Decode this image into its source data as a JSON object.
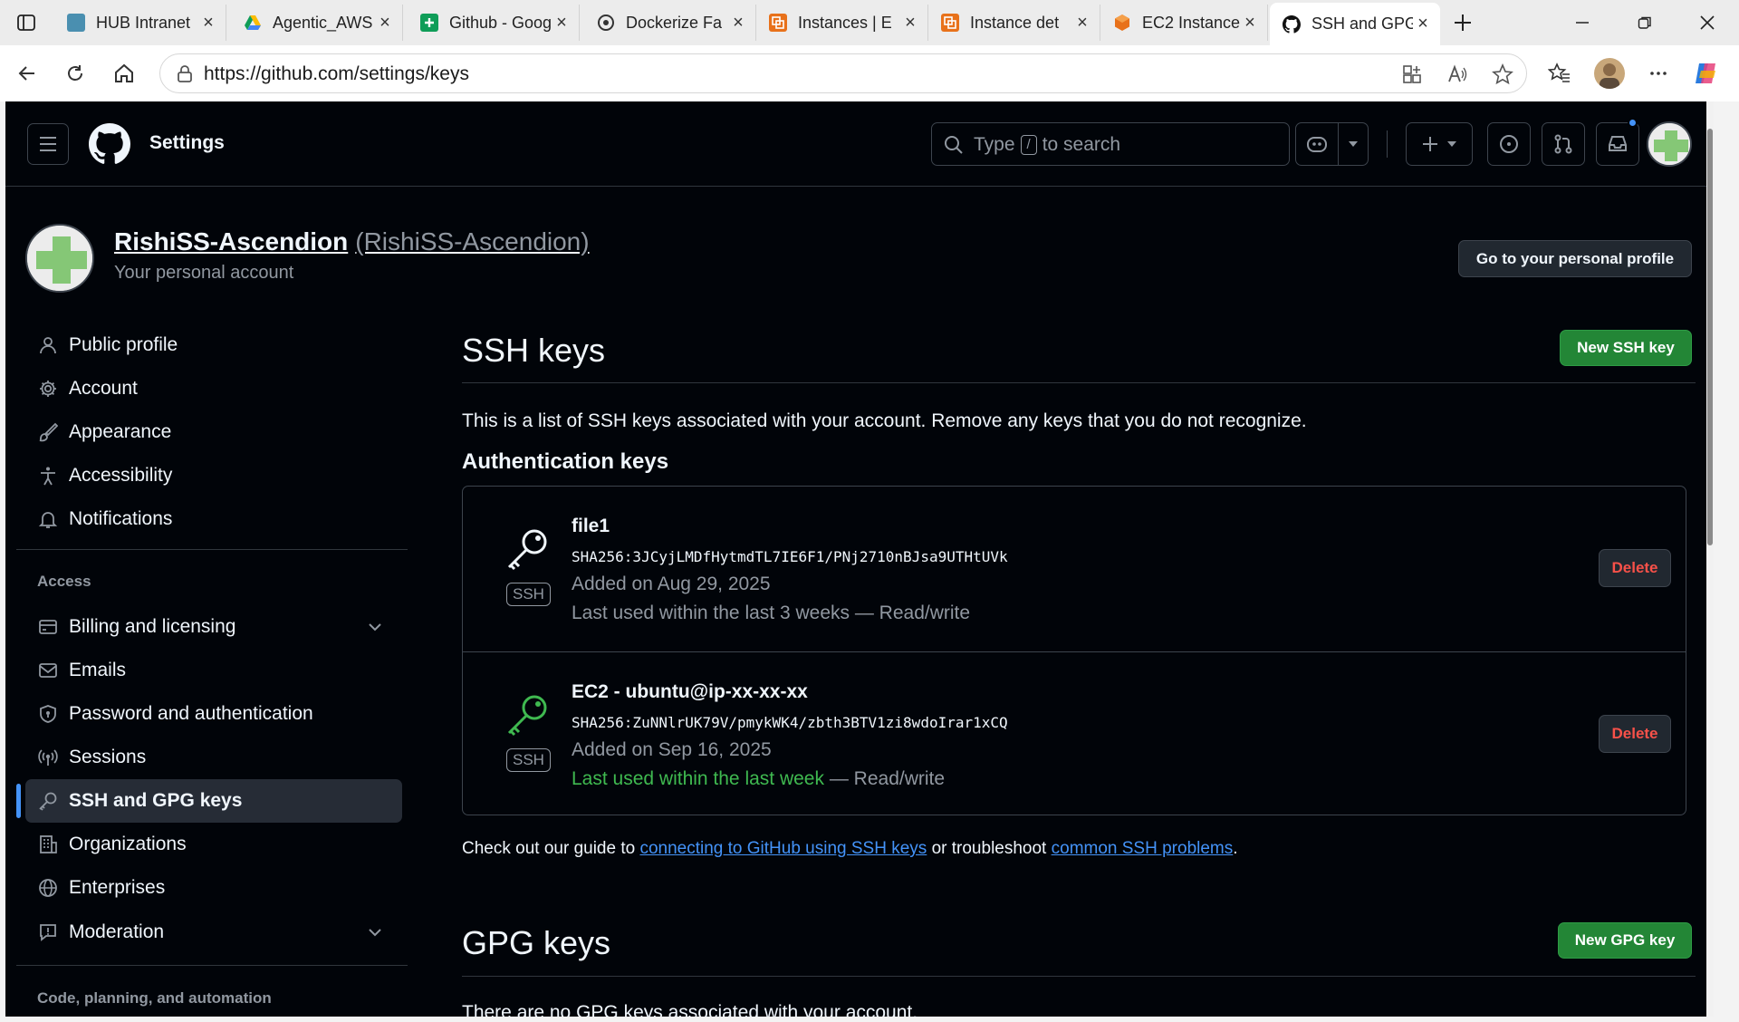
{
  "browser": {
    "tabs": [
      {
        "title": "HUB Intranet",
        "favicon_color": "#4a8fb0"
      },
      {
        "title": "Agentic_AWS",
        "favicon_color": "#4285f4"
      },
      {
        "title": "Github - Google",
        "favicon_color": "#0f9d58"
      },
      {
        "title": "Dockerize Fa",
        "favicon_color": "#333333"
      },
      {
        "title": "Instances | E",
        "favicon_color": "#e8711a"
      },
      {
        "title": "Instance det",
        "favicon_color": "#e8711a"
      },
      {
        "title": "EC2 Instance",
        "favicon_color": "#e8711a"
      },
      {
        "title": "SSH and GPG",
        "favicon_color": "#111111"
      }
    ],
    "url": "https://github.com/settings/keys"
  },
  "header": {
    "context": "Settings",
    "search_prefix": "Type",
    "search_key": "/",
    "search_suffix": "to search"
  },
  "account": {
    "name": "RishiSS-Ascendion",
    "login": "(RishiSS-Ascendion)",
    "subtitle": "Your personal account",
    "profile_button": "Go to your personal profile"
  },
  "sidebar": {
    "items": [
      {
        "label": "Public profile",
        "icon": "person-icon"
      },
      {
        "label": "Account",
        "icon": "gear-icon"
      },
      {
        "label": "Appearance",
        "icon": "paintbrush-icon"
      },
      {
        "label": "Accessibility",
        "icon": "accessibility-icon"
      },
      {
        "label": "Notifications",
        "icon": "bell-icon"
      }
    ],
    "access_heading": "Access",
    "access_items": [
      {
        "label": "Billing and licensing",
        "icon": "credit-card-icon"
      },
      {
        "label": "Emails",
        "icon": "mail-icon"
      },
      {
        "label": "Password and authentication",
        "icon": "shield-lock-icon"
      },
      {
        "label": "Sessions",
        "icon": "broadcast-icon"
      },
      {
        "label": "SSH and GPG keys",
        "icon": "key-icon",
        "selected": true
      },
      {
        "label": "Organizations",
        "icon": "organization-icon"
      },
      {
        "label": "Enterprises",
        "icon": "globe-icon"
      },
      {
        "label": "Moderation",
        "icon": "report-icon"
      }
    ],
    "code_heading": "Code, planning, and automation"
  },
  "ssh": {
    "title": "SSH keys",
    "new_button": "New SSH key",
    "description": "This is a list of SSH keys associated with your account. Remove any keys that you do not recognize.",
    "auth_heading": "Authentication keys",
    "keys": [
      {
        "title": "file1",
        "fingerprint": "SHA256:3JCyjLMDfHytmdTL7IE6F1/PNj2710nBJsa9UTHtUVk",
        "added": "Added on Aug 29, 2025",
        "used": "Last used within the last 3 weeks",
        "used_suffix": " — Read/write",
        "type": "SSH",
        "delete_label": "Delete",
        "icon_color": "#f0f6fc"
      },
      {
        "title": "EC2 - ubuntu@ip-xx-xx-xx",
        "fingerprint": "SHA256:ZuNNlrUK79V/pmykWK4/zbth3BTV1zi8wdoIrar1xCQ",
        "added": "Added on Sep 16, 2025",
        "used": "Last used within the last week",
        "used_suffix": " — Read/write",
        "type": "SSH",
        "delete_label": "Delete",
        "icon_color": "#3fb950"
      }
    ],
    "guide_prefix": "Check out our guide to ",
    "guide_link": "connecting to GitHub using SSH keys",
    "guide_middle": " or troubleshoot ",
    "guide_link2": "common SSH problems",
    "guide_suffix": "."
  },
  "gpg": {
    "title": "GPG keys",
    "new_button": "New GPG key",
    "empty_text": "There are no GPG keys associated with your account."
  },
  "colors": {
    "page_bg": "#010409",
    "accent": "#4493f8",
    "primary_green": "#238636",
    "danger": "#f85149"
  }
}
